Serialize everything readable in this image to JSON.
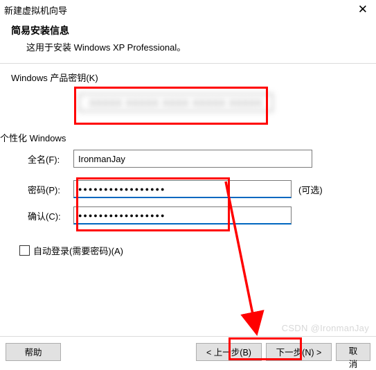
{
  "titlebar": {
    "title": "新建虚拟机向导",
    "close": "✕"
  },
  "header": {
    "title": "简易安装信息",
    "subtitle": "这用于安装 Windows XP Professional。"
  },
  "product_key": {
    "section_label": "Windows 产品密钥(K)",
    "value": "XXXXX XXXXX XXXX XXXXX XXXXX"
  },
  "personalize": {
    "section_label": "个性化 Windows",
    "fullname_label": "全名(F):",
    "fullname_value": "IronmanJay",
    "password_label": "密码(P):",
    "password_value": "●●●●●●●●●●●●●●●●●",
    "optional_text": "(可选)",
    "confirm_label": "确认(C):",
    "confirm_value": "●●●●●●●●●●●●●●●●●"
  },
  "autologin": {
    "label": "自动登录(需要密码)(A)",
    "checked": false
  },
  "footer": {
    "help": "帮助",
    "back": "< 上一步(B)",
    "next": "下一步(N) >",
    "cancel": "取消"
  },
  "watermark": "CSDN @IronmanJay"
}
